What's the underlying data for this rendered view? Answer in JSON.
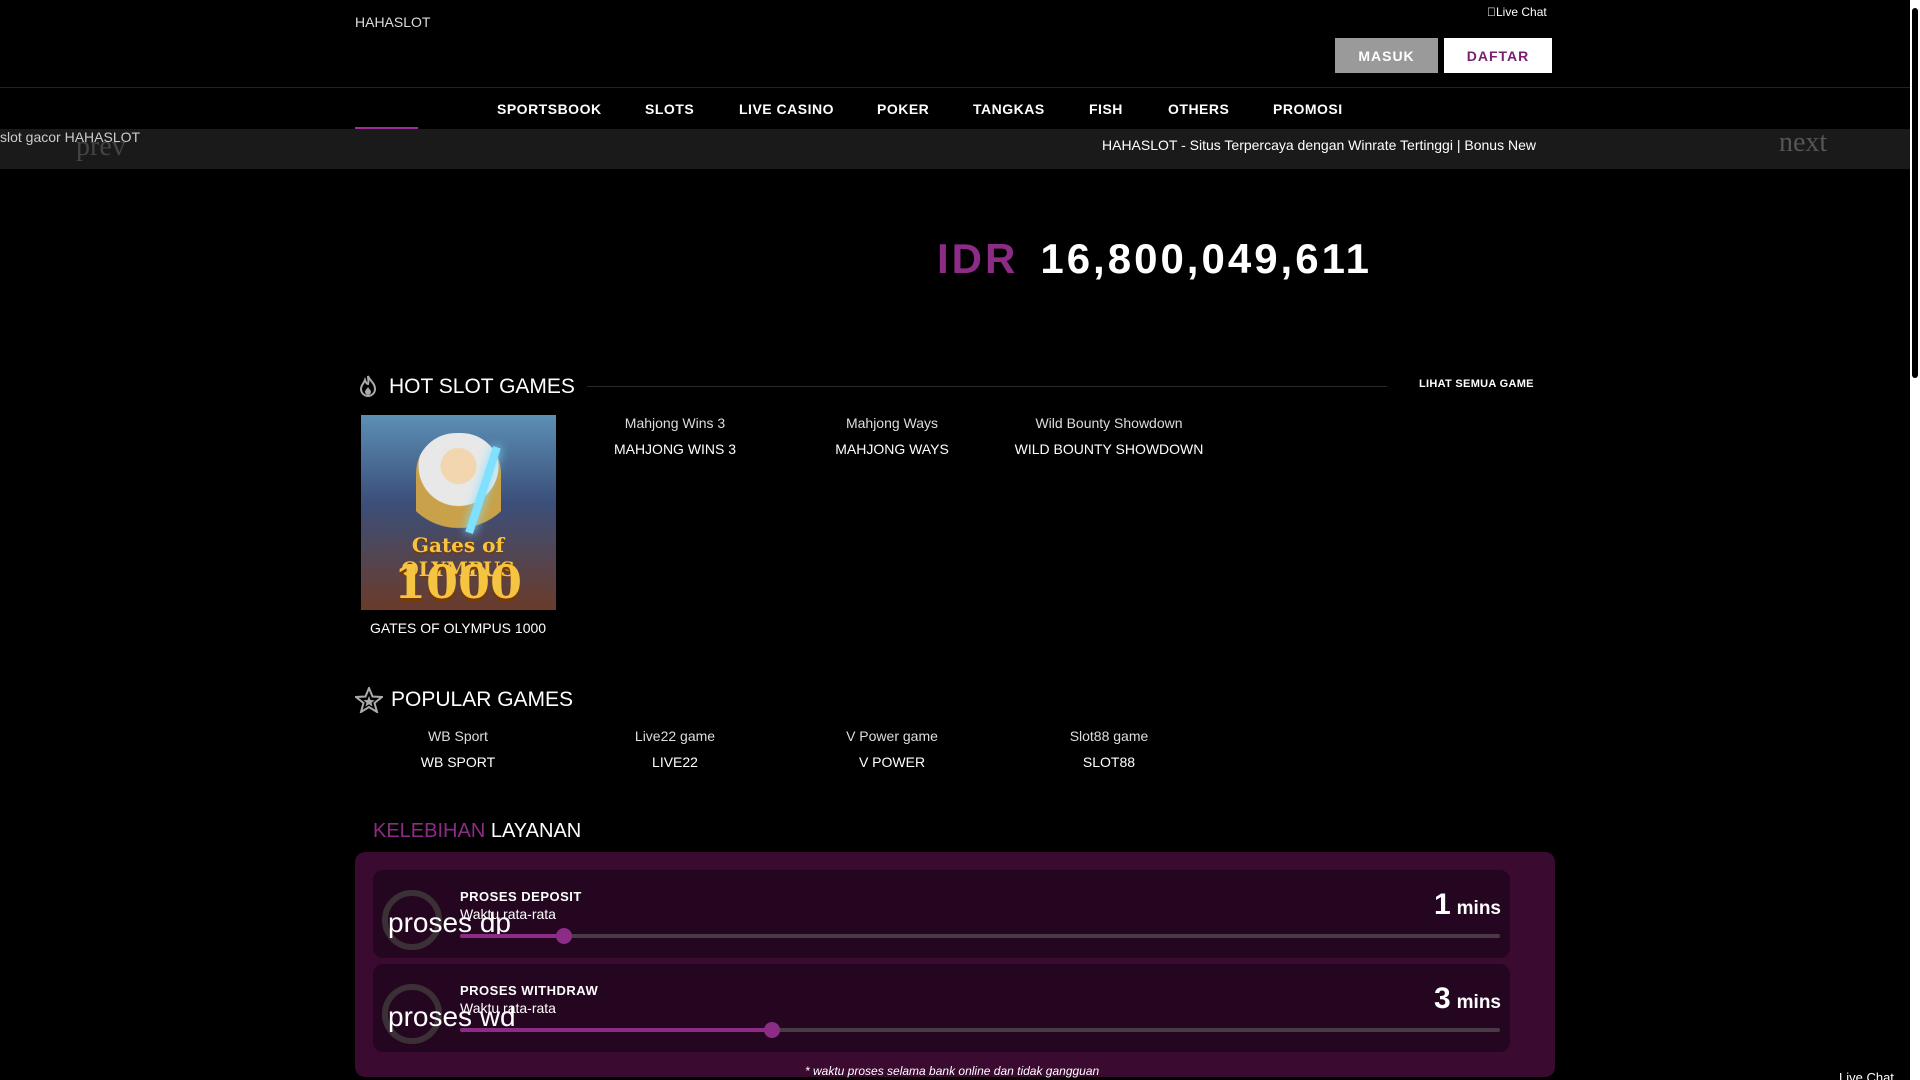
{
  "header": {
    "logo_alt": "HAHASLOT",
    "live_chat": "Live Chat",
    "masuk": "MASUK",
    "daftar": "DAFTAR"
  },
  "nav": {
    "home_icon": "",
    "items": [
      "SPORTSBOOK",
      "SLOTS",
      "LIVE CASINO",
      "POKER",
      "TANGKAS",
      "FISH",
      "OTHERS",
      "PROMOSI"
    ]
  },
  "banner": {
    "alt": "slot gacor HAHASLOT",
    "prev": "prev",
    "next": "next",
    "marquee_icon": "",
    "marquee": "HAHASLOT - Situs Terpercaya dengan Winrate Tertinggi | Bonus New"
  },
  "jackpot": {
    "currency": "IDR",
    "amount": "16,800,049,611"
  },
  "hot": {
    "title": "HOT SLOT GAMES",
    "see_all": "LIHAT SEMUA GAME",
    "thumb_text_1": "Gates of OLYMPUS",
    "thumb_text_2": "1000",
    "games": [
      {
        "alt": "",
        "label": "GATES OF OLYMPUS 1000"
      },
      {
        "alt": "Mahjong Wins 3",
        "label": "MAHJONG WINS 3"
      },
      {
        "alt": "Mahjong Ways",
        "label": "MAHJONG WAYS"
      },
      {
        "alt": "Wild Bounty Showdown",
        "label": "WILD BOUNTY SHOWDOWN"
      }
    ]
  },
  "popular": {
    "title": "POPULAR GAMES",
    "games": [
      {
        "alt": "WB Sport",
        "label": "WB SPORT"
      },
      {
        "alt": "Live22 game",
        "label": "LIVE22"
      },
      {
        "alt": "V Power game",
        "label": "V POWER"
      },
      {
        "alt": "Slot88 game",
        "label": "SLOT88"
      }
    ]
  },
  "kelebihan": {
    "title_a": "KELEBIHAN",
    "title_b": "LAYANAN",
    "deposit": {
      "icon_alt": "proses dp",
      "title": "PROSES DEPOSIT",
      "sub": "Waktu rata-rata",
      "value": "1",
      "unit": "mins",
      "progress": 0.1
    },
    "withdraw": {
      "icon_alt": "proses wd",
      "title": "PROSES WITHDRAW",
      "sub": "Waktu rata-rata",
      "value": "3",
      "unit": "mins",
      "progress": 0.3
    },
    "note": "* waktu proses selama bank online dan tidak gangguan"
  },
  "corner_live_chat": "Live Chat",
  "colors": {
    "accent": "#8c2c86",
    "panel": "#3a0a30",
    "panel_inner": "#250620"
  }
}
